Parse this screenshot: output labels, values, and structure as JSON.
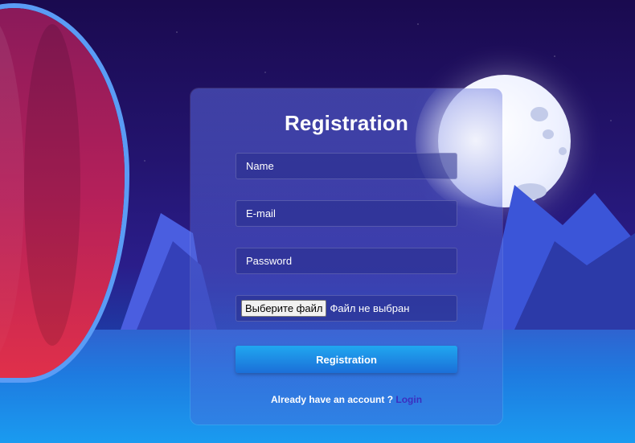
{
  "form": {
    "title": "Registration",
    "name_placeholder": "Name",
    "email_placeholder": "E-mail",
    "password_placeholder": "Password",
    "file_button_label": "Выберите файл",
    "file_status": "Файл не выбран",
    "submit_label": "Registration",
    "footer_text": "Already have an account ?",
    "login_link": "Login"
  },
  "colors": {
    "accent_button": "#1b8fe6",
    "link": "#3b2fc0",
    "card_bg": "#5a69dc"
  }
}
